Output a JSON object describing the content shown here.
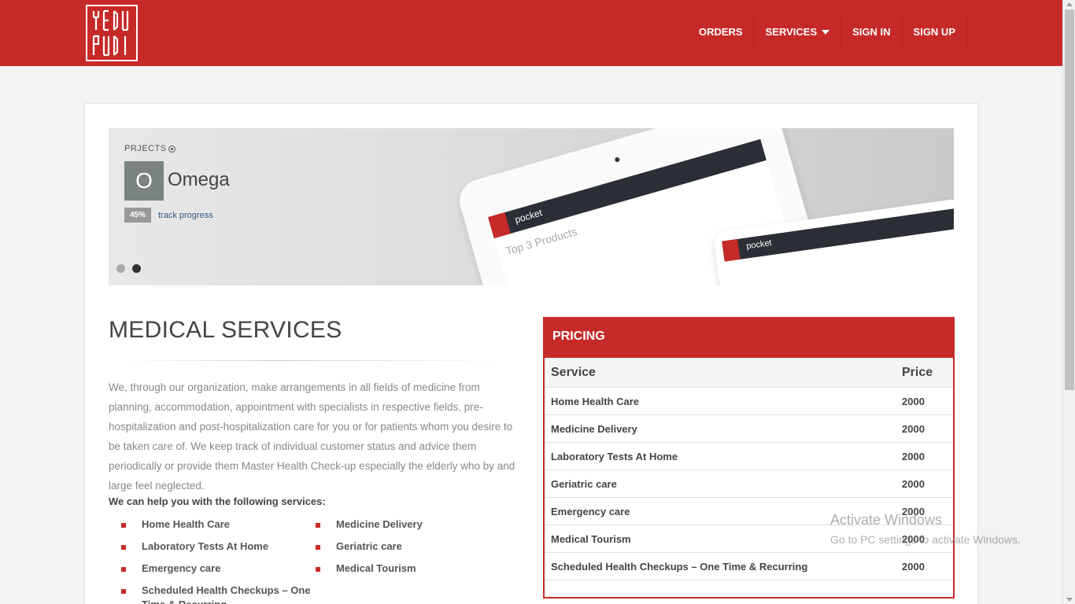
{
  "brand": {
    "logo_text": "yedu pudi"
  },
  "nav": {
    "items": [
      {
        "label": "ORDERS"
      },
      {
        "label": "SERVICES"
      },
      {
        "label": "SIGN IN"
      },
      {
        "label": "SIGN UP"
      }
    ]
  },
  "slider": {
    "section_label": "PRJECTS",
    "project_initial": "O",
    "project_name": "Omega",
    "progress_badge": "45%",
    "progress_value": 45,
    "progress_link": "track progress",
    "active_slide": 2,
    "slide_count": 2,
    "tablet_app": "pocket",
    "tablet_heading": "Top 3 Products"
  },
  "medical": {
    "title": "MEDICAL SERVICES",
    "description": "We, through our organization, make arrangements in all fields of medicine from planning, accommodation, appointment with specialists in respective fields, pre-hospitalization and post-hospitalization care for you or for patients whom you desire to be taken care of. We keep track of individual customer status and advice them periodically or provide them Master Health Check-up especially the elderly who by and large feel neglected.",
    "help_title": "We can help you with the following services:",
    "services": [
      "Home Health Care",
      "Medicine Delivery",
      "Laboratory Tests At Home",
      "Geriatric care",
      "Emergency care",
      "Medical Tourism",
      "Scheduled Health Checkups – One Time & Recurring"
    ]
  },
  "pricing": {
    "title": "PRICING",
    "headers": {
      "service": "Service",
      "price": "Price"
    },
    "rows": [
      {
        "service": "Home Health Care",
        "price": "2000"
      },
      {
        "service": "Medicine Delivery",
        "price": "2000"
      },
      {
        "service": "Laboratory Tests At Home",
        "price": "2000"
      },
      {
        "service": "Geriatric care",
        "price": "2000"
      },
      {
        "service": "Emergency care",
        "price": "2000"
      },
      {
        "service": "Medical Tourism",
        "price": "2000"
      },
      {
        "service": "Scheduled Health Checkups – One Time & Recurring",
        "price": "2000"
      }
    ]
  },
  "watermark": {
    "line1": "Activate Windows",
    "line2": "Go to PC settings to activate Windows."
  },
  "colors": {
    "brand_red": "#c62a28",
    "background": "#f3f3f3"
  }
}
